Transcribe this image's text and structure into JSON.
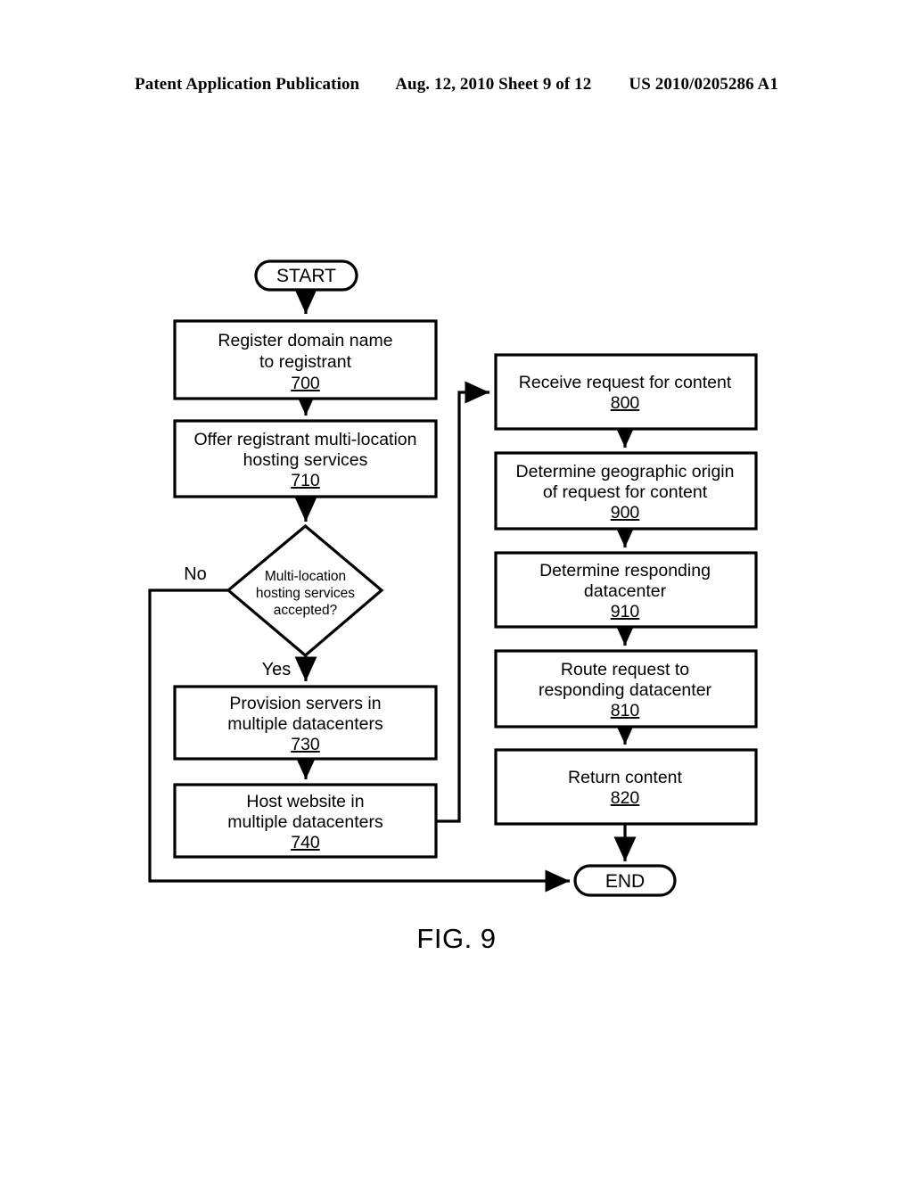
{
  "header": {
    "left": "Patent Application Publication",
    "middle": "Aug. 12, 2010  Sheet 9 of 12",
    "right": "US 2010/0205286 A1"
  },
  "figure": {
    "caption": "FIG. 9"
  },
  "flowchart": {
    "start_label": "START",
    "end_label": "END",
    "edge_labels": {
      "no": "No",
      "yes": "Yes"
    },
    "nodes": [
      {
        "id": "700",
        "shape": "process",
        "lines": [
          "Register domain name",
          "to registrant"
        ],
        "number": "700"
      },
      {
        "id": "710",
        "shape": "process",
        "lines": [
          "Offer registrant multi-location",
          "hosting services"
        ],
        "number": "710"
      },
      {
        "id": "decision",
        "shape": "decision",
        "lines": [
          "Multi-location",
          "hosting services",
          "accepted?"
        ],
        "number": ""
      },
      {
        "id": "730",
        "shape": "process",
        "lines": [
          "Provision servers in",
          "multiple datacenters"
        ],
        "number": "730"
      },
      {
        "id": "740",
        "shape": "process",
        "lines": [
          "Host website in",
          "multiple datacenters"
        ],
        "number": "740"
      },
      {
        "id": "800",
        "shape": "process",
        "lines": [
          "Receive request for content"
        ],
        "number": "800"
      },
      {
        "id": "900",
        "shape": "process",
        "lines": [
          "Determine geographic origin",
          "of request for content"
        ],
        "number": "900"
      },
      {
        "id": "910",
        "shape": "process",
        "lines": [
          "Determine responding",
          "datacenter"
        ],
        "number": "910"
      },
      {
        "id": "810",
        "shape": "process",
        "lines": [
          "Route request to",
          "responding datacenter"
        ],
        "number": "810"
      },
      {
        "id": "820",
        "shape": "process",
        "lines": [
          "Return content"
        ],
        "number": "820"
      }
    ]
  },
  "colors": {
    "ink": "#000000",
    "paper": "#ffffff"
  }
}
